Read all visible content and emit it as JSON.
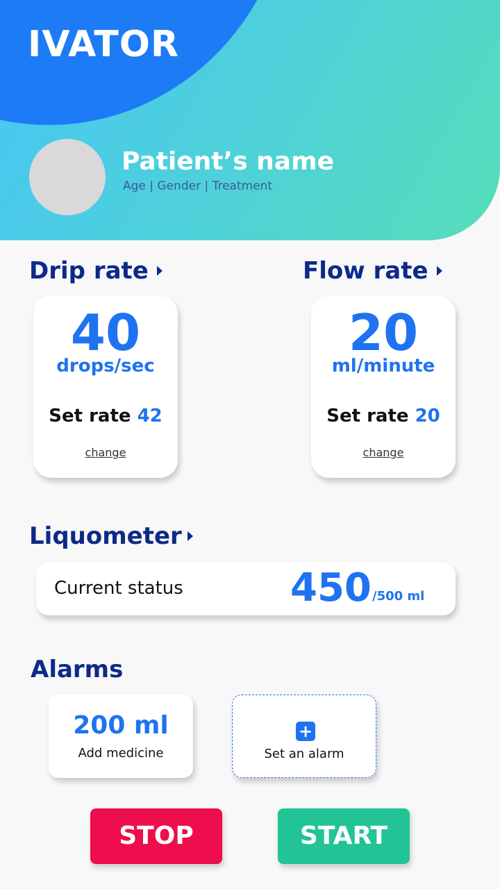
{
  "app": {
    "title": "IVATOR"
  },
  "patient": {
    "name": "Patient’s name",
    "meta": "Age | Gender | Treatment"
  },
  "drip": {
    "title": "Drip rate",
    "value": "40",
    "unit": "drops/sec",
    "set_label": "Set rate",
    "set_value": "42",
    "change_label": "change"
  },
  "flow": {
    "title": "Flow rate",
    "value": "20",
    "unit": "ml/minute",
    "set_label": "Set rate",
    "set_value": "20",
    "change_label": "change"
  },
  "liquometer": {
    "title": "Liquometer",
    "label": "Current status",
    "value": "450",
    "total": "/500 ml"
  },
  "alarms": {
    "title": "Alarms",
    "items": [
      {
        "value": "200 ml",
        "label": "Add medicine"
      }
    ],
    "add_label": "Set an alarm"
  },
  "actions": {
    "stop": "STOP",
    "start": "START"
  },
  "colors": {
    "accent": "#1f73f0",
    "heading": "#0d2a8a",
    "stop": "#ee0d4d",
    "start": "#22c495"
  },
  "icons": {
    "section_arrow": "chevron-right-icon",
    "add": "plus-icon"
  }
}
